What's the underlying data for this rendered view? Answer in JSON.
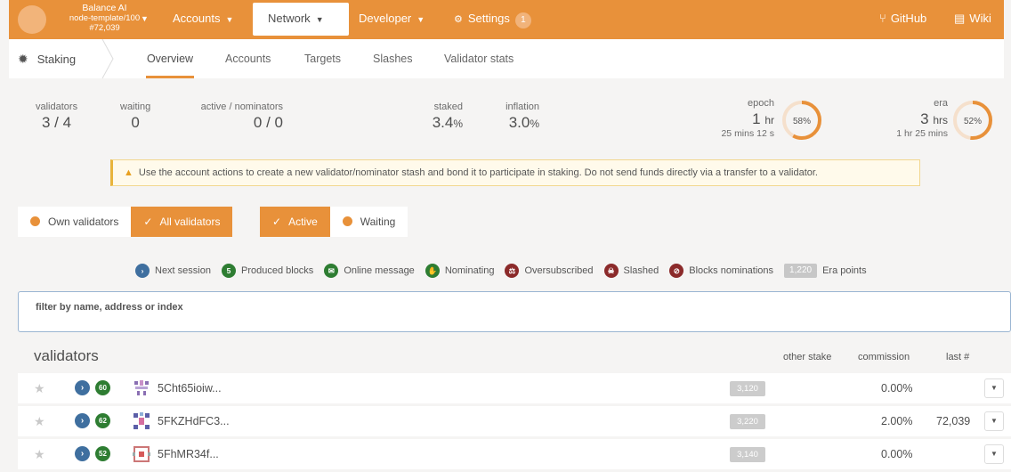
{
  "topbar": {
    "chain_name": "Balance AI",
    "runtime": "node-template/100",
    "block": "#72,039",
    "menus": [
      {
        "label": "Accounts"
      },
      {
        "label": "Network"
      },
      {
        "label": "Developer"
      },
      {
        "label": "Settings",
        "badge": "1"
      }
    ],
    "github": "GitHub",
    "wiki": "Wiki"
  },
  "subnav": {
    "section": "Staking",
    "tabs": [
      "Overview",
      "Accounts",
      "Targets",
      "Slashes",
      "Validator stats"
    ]
  },
  "summary": {
    "validators_label": "validators",
    "validators_value": "3 / 4",
    "waiting_label": "waiting",
    "waiting_value": "0",
    "active_label": "active / nominators",
    "active_value": "0 / 0",
    "staked_label": "staked",
    "staked_value": "3.4",
    "staked_unit": "%",
    "inflation_label": "inflation",
    "inflation_value": "3.0",
    "inflation_unit": "%",
    "epoch_label": "epoch",
    "epoch_value": "1",
    "epoch_unit": "hr",
    "epoch_sub": "25 mins 12 s",
    "epoch_percent": 58,
    "epoch_percent_label": "58%",
    "era_label": "era",
    "era_value": "3",
    "era_unit": "hrs",
    "era_sub": "1 hr 25 mins",
    "era_percent": 52,
    "era_percent_label": "52%"
  },
  "notice": "Use the account actions to create a new validator/nominator stash and bond it to participate in staking. Do not send funds directly via a transfer to a validator.",
  "toggles": {
    "own": "Own validators",
    "all": "All validators",
    "active": "Active",
    "waiting": "Waiting"
  },
  "legend": {
    "next_session": "Next session",
    "produced_badge": "5",
    "produced": "Produced blocks",
    "online": "Online message",
    "nominating": "Nominating",
    "oversubscribed": "Oversubscribed",
    "slashed": "Slashed",
    "blocks_nominations": "Blocks nominations",
    "era_points_badge": "1,220",
    "era_points": "Era points"
  },
  "filter": {
    "label": "filter by name, address or index",
    "value": ""
  },
  "table": {
    "title": "validators",
    "col_other_stake": "other stake",
    "col_commission": "commission",
    "col_last": "last #",
    "rows": [
      {
        "blocks": "60",
        "address": "5Cht65ioiw...",
        "era_points": "3,120",
        "commission": "0.00%",
        "last": ""
      },
      {
        "blocks": "62",
        "address": "5FKZHdFC3...",
        "era_points": "3,220",
        "commission": "2.00%",
        "last": "72,039"
      },
      {
        "blocks": "52",
        "address": "5FhMR34f...",
        "era_points": "3,140",
        "commission": "0.00%",
        "last": ""
      }
    ]
  },
  "colors": {
    "accent": "#e8913a",
    "blue_badge": "#3f6f9f",
    "green_badge": "#2e7d32",
    "red_badge": "#8b2a2a"
  }
}
